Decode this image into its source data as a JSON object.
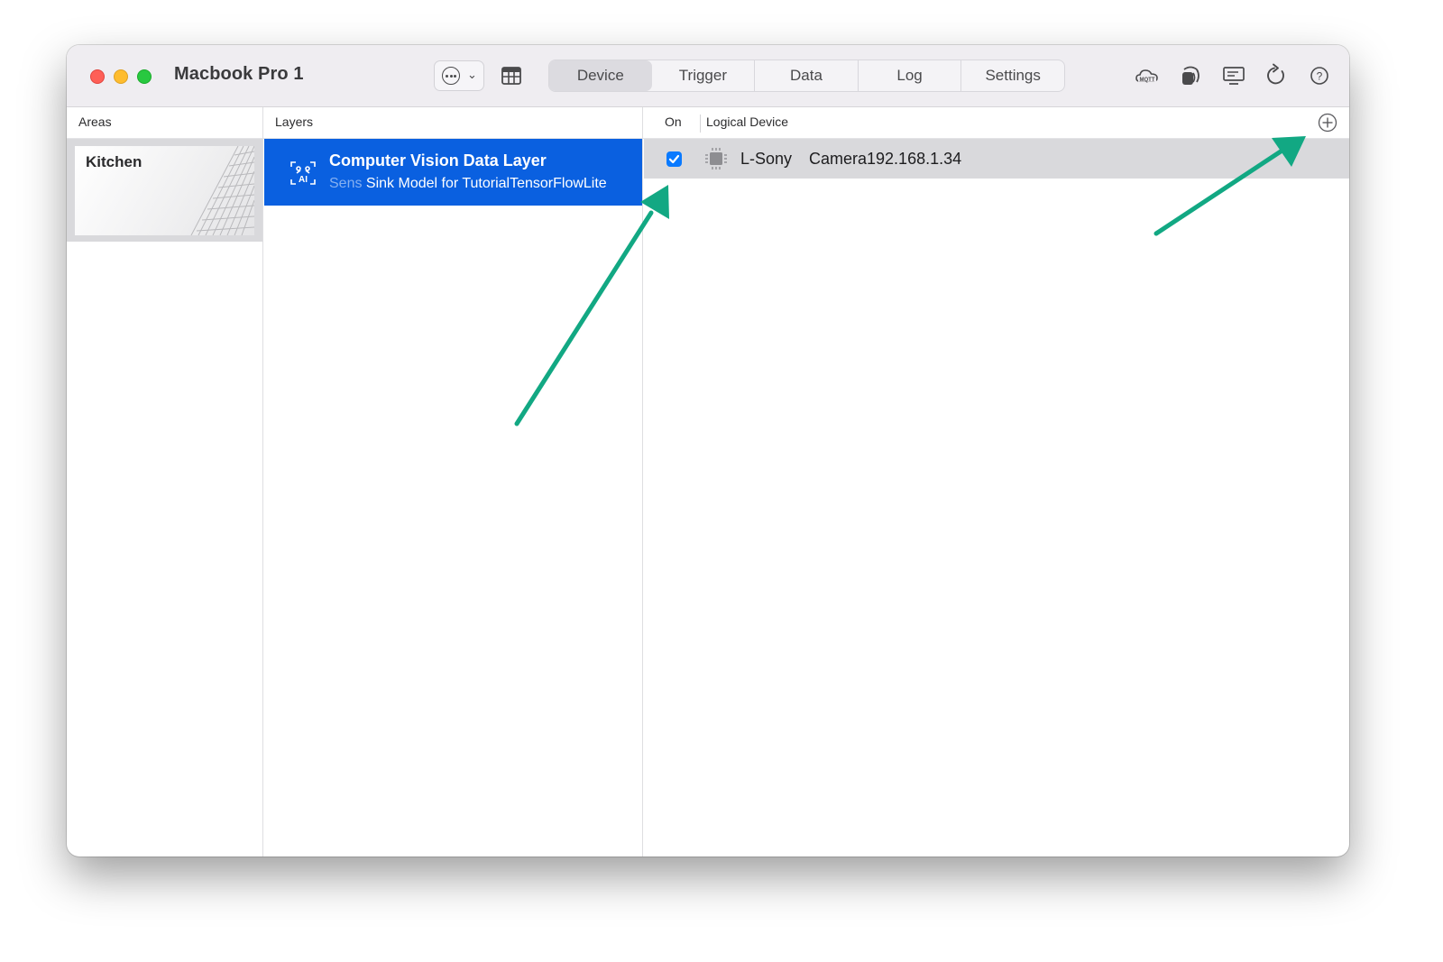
{
  "window": {
    "title": "Macbook Pro 1"
  },
  "toolbar": {
    "tabs": [
      {
        "label": "Device",
        "active": true
      },
      {
        "label": "Trigger",
        "active": false
      },
      {
        "label": "Data",
        "active": false
      },
      {
        "label": "Log",
        "active": false
      },
      {
        "label": "Settings",
        "active": false
      }
    ],
    "icons": [
      "more-options-icon",
      "table-icon",
      "mqtt-cloud-icon",
      "sensor-icon",
      "display-icon",
      "refresh-icon",
      "help-icon"
    ]
  },
  "columns": {
    "areas": "Areas",
    "layers": "Layers",
    "on": "On",
    "logical_device": "Logical Device"
  },
  "areas": [
    {
      "name": "Kitchen",
      "selected": true
    }
  ],
  "layers": [
    {
      "title": "Computer Vision Data Layer",
      "subtitle_prefix": "Sens",
      "subtitle": "Sink Model for TutorialTensorFlowLite",
      "selected": true
    }
  ],
  "devices": [
    {
      "on": true,
      "name": "L-Sony",
      "address": "Camera192.168.1.34"
    }
  ],
  "colors": {
    "selection_blue": "#0a60e0",
    "checkbox_blue": "#0a7aff",
    "annotation_arrow": "#12a883"
  }
}
